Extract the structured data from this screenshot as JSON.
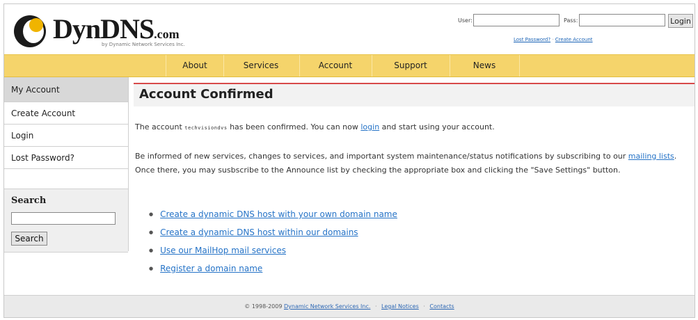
{
  "brand": {
    "name": "DynDNS",
    "suffix": ".com",
    "tagline": "by Dynamic Network Services Inc."
  },
  "login": {
    "user_label": "User:",
    "pass_label": "Pass:",
    "user_value": "",
    "pass_value": "",
    "button": "Login",
    "lost_password": "Lost Password?",
    "separator": "·",
    "create_account": "Create Account"
  },
  "nav": {
    "items": [
      "About",
      "Services",
      "Account",
      "Support",
      "News"
    ]
  },
  "sidebar": {
    "items": [
      "My Account",
      "Create Account",
      "Login",
      "Lost Password?"
    ],
    "search_title": "Search",
    "search_value": "",
    "search_button": "Search"
  },
  "main": {
    "title": "Account Confirmed",
    "p1_before": "The account ",
    "p1_username": "techvisiondvs",
    "p1_mid": " has been confirmed. You can now ",
    "p1_link": "login",
    "p1_after": " and start using your account.",
    "p2_before": "Be informed of new services, changes to services, and important system maintenance/status notifications by subscribing to our ",
    "p2_link": "mailing lists",
    "p2_after": ". Once there, you may susbscribe to the Announce list by checking the appropriate box and clicking the \"Save Settings\" button.",
    "links": [
      "Create a dynamic DNS host with your own domain name",
      "Create a dynamic DNS host within our domains",
      "Use our MailHop mail services",
      "Register a domain name"
    ]
  },
  "footer": {
    "copyright": "© 1998-2009",
    "company": "Dynamic Network Services Inc.",
    "legal": "Legal Notices",
    "contacts": "Contacts",
    "separator": "·"
  },
  "colors": {
    "nav_bg": "#f5d46b",
    "title_rule": "#d84a4a",
    "link": "#2573c7",
    "logo_accent": "#f0b400"
  }
}
